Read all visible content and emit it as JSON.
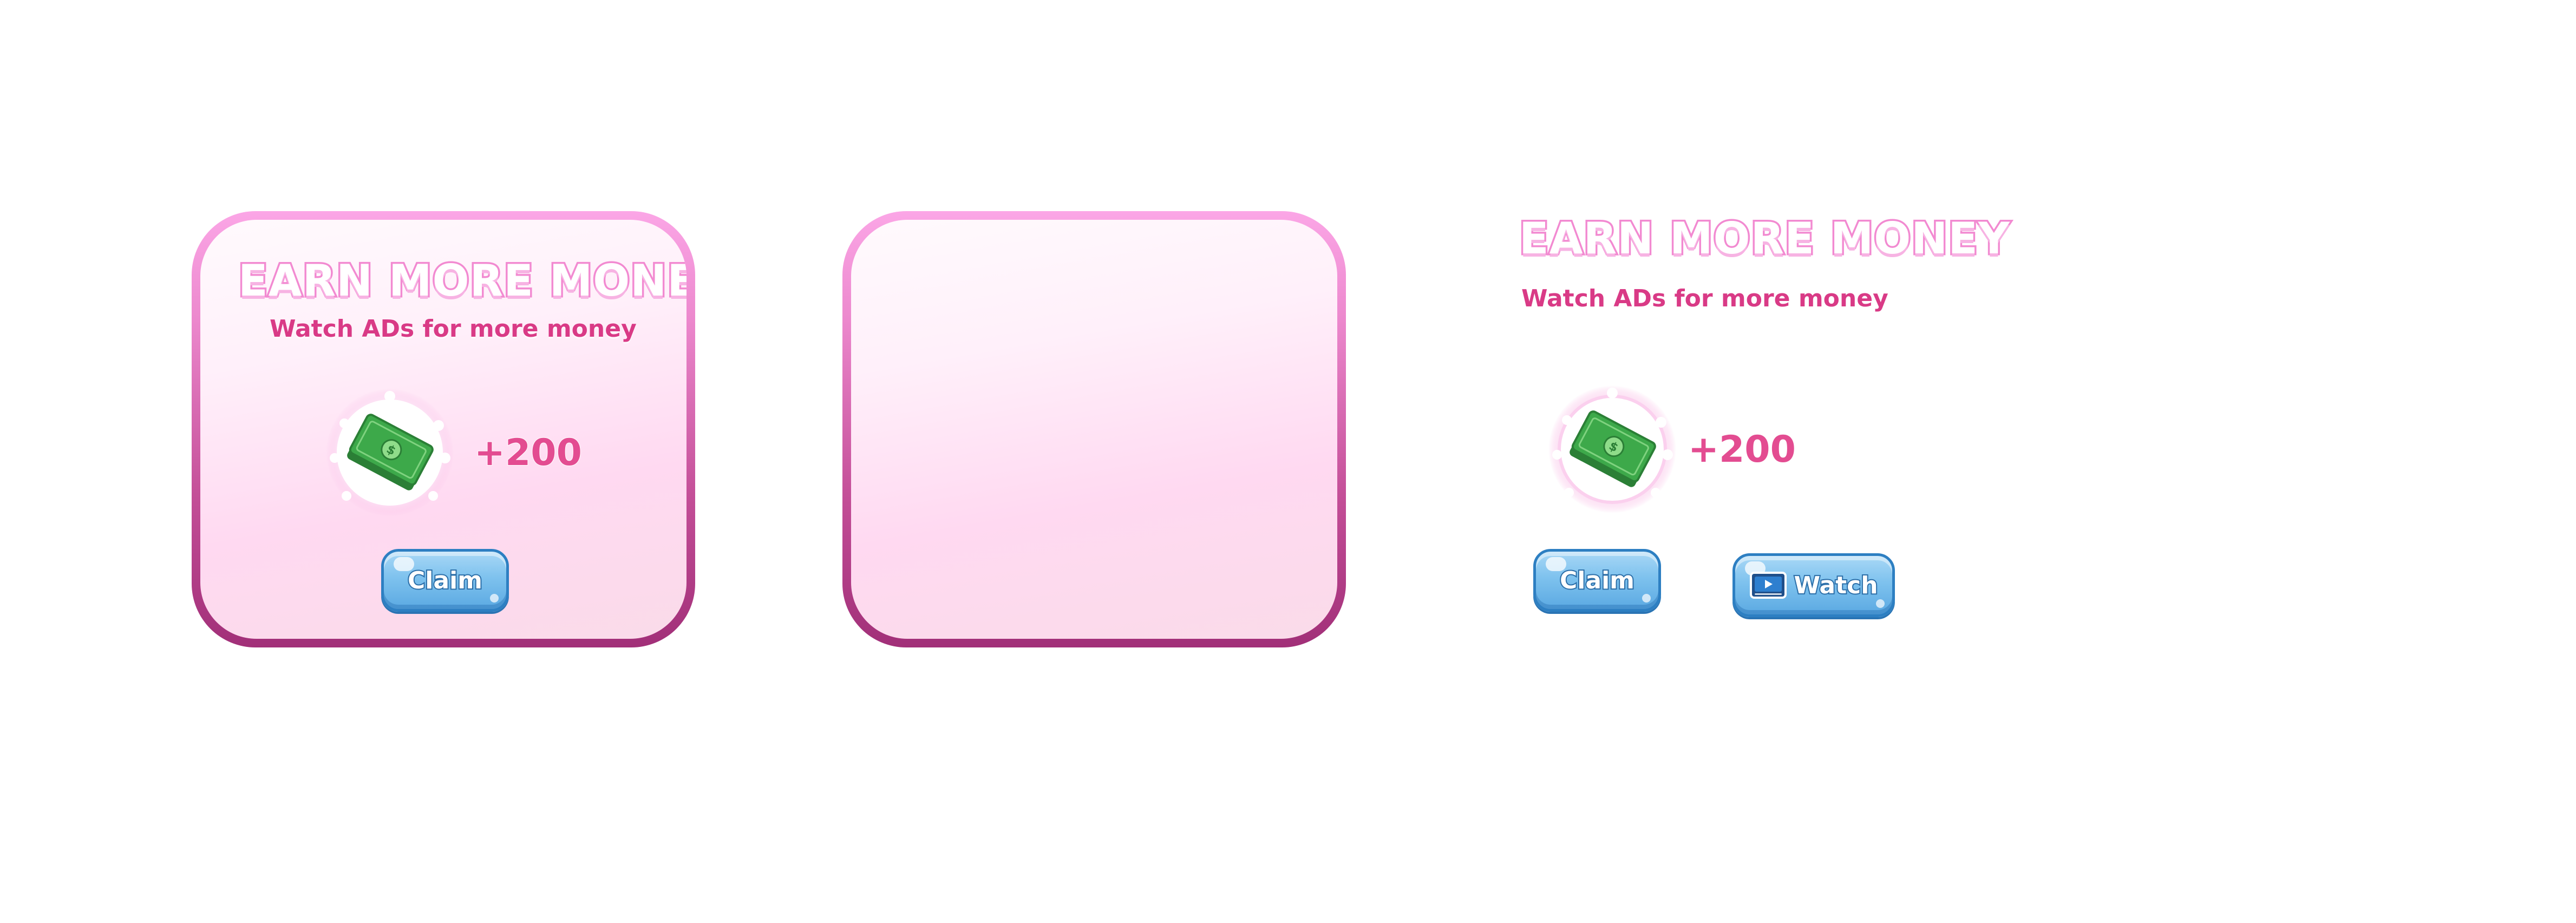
{
  "colors": {
    "panel_border_top": "#fba6e6",
    "panel_border_bottom": "#a12f78",
    "panel_fill": "#ffe3f4",
    "title_outline": "#f28ad1",
    "subtitle_text": "#d93a86",
    "amount_text": "#e34c91",
    "button_fill": "#7ec2ee",
    "button_border": "#2d7fc2",
    "cash_green": "#3da94a"
  },
  "panel_a": {
    "title": "EARN MORE MONEY",
    "subtitle": "Watch ADs for more money",
    "reward_icon": "cash-bill-icon",
    "reward_amount": "+200",
    "claim_label": "Claim"
  },
  "panel_b": {},
  "loose_assets": {
    "title": "EARN MORE MONEY",
    "subtitle": "Watch ADs for more money",
    "reward_icon": "cash-bill-icon",
    "reward_amount": "+200",
    "claim_label": "Claim",
    "watch_icon": "video-ad-icon",
    "watch_label": "Watch"
  }
}
